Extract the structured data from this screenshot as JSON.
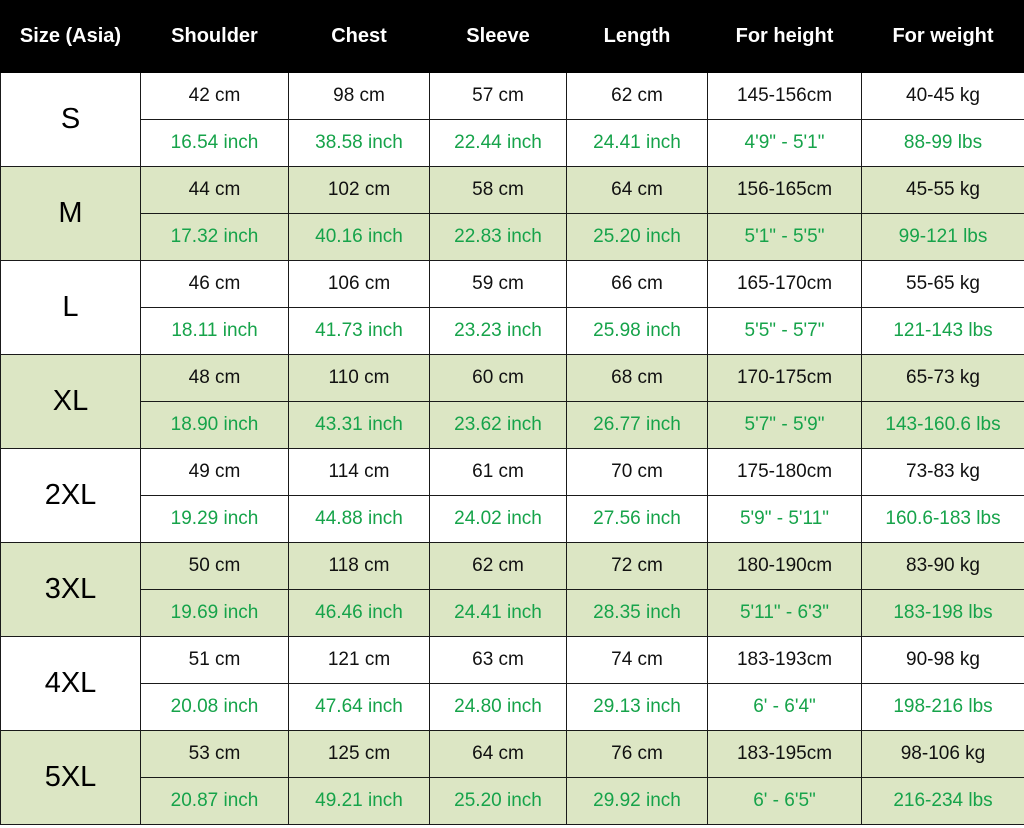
{
  "headers": [
    "Size (Asia)",
    "Shoulder",
    "Chest",
    "Sleeve",
    "Length",
    "For height",
    "For weight"
  ],
  "colors": {
    "header_bg": "#000000",
    "header_text": "#ffffff",
    "shaded_row": "#dce6c4",
    "imperial_text": "#16a34a",
    "metric_text": "#111111"
  },
  "rows": [
    {
      "size": "S",
      "shaded": false,
      "metric": [
        "42 cm",
        "98 cm",
        "57 cm",
        "62 cm",
        "145-156cm",
        "40-45 kg"
      ],
      "imperial": [
        "16.54 inch",
        "38.58 inch",
        "22.44 inch",
        "24.41 inch",
        "4'9\" - 5'1\"",
        "88-99 lbs"
      ]
    },
    {
      "size": "M",
      "shaded": true,
      "metric": [
        "44 cm",
        "102 cm",
        "58 cm",
        "64 cm",
        "156-165cm",
        "45-55 kg"
      ],
      "imperial": [
        "17.32 inch",
        "40.16 inch",
        "22.83 inch",
        "25.20 inch",
        "5'1\" - 5'5\"",
        "99-121 lbs"
      ]
    },
    {
      "size": "L",
      "shaded": false,
      "metric": [
        "46 cm",
        "106 cm",
        "59 cm",
        "66 cm",
        "165-170cm",
        "55-65 kg"
      ],
      "imperial": [
        "18.11 inch",
        "41.73 inch",
        "23.23 inch",
        "25.98 inch",
        "5'5\" - 5'7\"",
        "121-143 lbs"
      ]
    },
    {
      "size": "XL",
      "shaded": true,
      "metric": [
        "48 cm",
        "110 cm",
        "60 cm",
        "68 cm",
        "170-175cm",
        "65-73 kg"
      ],
      "imperial": [
        "18.90 inch",
        "43.31 inch",
        "23.62 inch",
        "26.77 inch",
        "5'7\" - 5'9\"",
        "143-160.6 lbs"
      ]
    },
    {
      "size": "2XL",
      "shaded": false,
      "metric": [
        "49 cm",
        "114 cm",
        "61 cm",
        "70 cm",
        "175-180cm",
        "73-83 kg"
      ],
      "imperial": [
        "19.29 inch",
        "44.88 inch",
        "24.02 inch",
        "27.56 inch",
        "5'9\" - 5'11\"",
        "160.6-183 lbs"
      ]
    },
    {
      "size": "3XL",
      "shaded": true,
      "metric": [
        "50 cm",
        "118 cm",
        "62 cm",
        "72 cm",
        "180-190cm",
        "83-90 kg"
      ],
      "imperial": [
        "19.69 inch",
        "46.46 inch",
        "24.41 inch",
        "28.35 inch",
        "5'11\" - 6'3\"",
        "183-198 lbs"
      ]
    },
    {
      "size": "4XL",
      "shaded": false,
      "metric": [
        "51 cm",
        "121 cm",
        "63 cm",
        "74 cm",
        "183-193cm",
        "90-98 kg"
      ],
      "imperial": [
        "20.08 inch",
        "47.64 inch",
        "24.80 inch",
        "29.13 inch",
        "6' - 6'4\"",
        "198-216 lbs"
      ]
    },
    {
      "size": "5XL",
      "shaded": true,
      "metric": [
        "53 cm",
        "125 cm",
        "64 cm",
        "76 cm",
        "183-195cm",
        "98-106 kg"
      ],
      "imperial": [
        "20.87 inch",
        "49.21 inch",
        "25.20 inch",
        "29.92 inch",
        "6' - 6'5\"",
        "216-234 lbs"
      ]
    }
  ]
}
